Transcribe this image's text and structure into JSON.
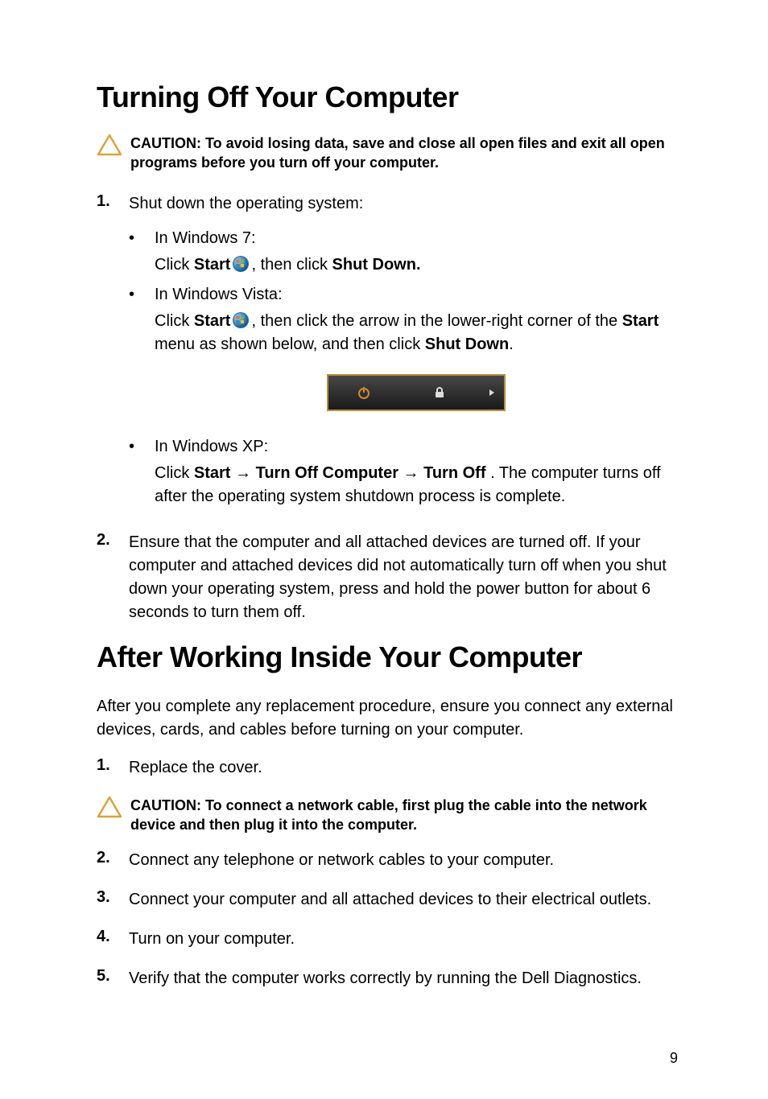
{
  "section1": {
    "heading": "Turning Off Your Computer",
    "caution": "CAUTION: To avoid losing data, save and close all open files and exit all open programs before you turn off your computer.",
    "step1_intro": "Shut down the operating system:",
    "win7_label": "In Windows 7:",
    "win7_pre": "Click ",
    "win7_start": "Start",
    "win7_post": ", then click ",
    "win7_shutdown": "Shut Down.",
    "vista_label": "In Windows Vista:",
    "vista_pre": "Click ",
    "vista_start": "Start",
    "vista_mid": ", then click the arrow in the lower-right corner of the ",
    "vista_start2": "Start",
    "vista_mid2": " menu as shown below, and then click ",
    "vista_shutdown": "Shut Down",
    "vista_period": ".",
    "xp_label": "In Windows XP:",
    "xp_pre": "Click ",
    "xp_start": "Start",
    "xp_arrow1": " → ",
    "xp_turnoffcomp": "Turn Off Computer",
    "xp_arrow2": " → ",
    "xp_turnoff": "Turn Off ",
    "xp_post": ". The computer turns off after the operating system shutdown process is complete.",
    "step2": "Ensure that the computer and all attached devices are turned off. If your computer and attached devices did not automatically turn off when you shut down your operating system, press and hold the power button for about 6 seconds to turn them off."
  },
  "section2": {
    "heading": "After Working Inside Your Computer",
    "intro": "After you complete any replacement procedure, ensure you connect any external devices, cards, and cables before turning on your computer.",
    "step1": "Replace the cover.",
    "caution": "CAUTION: To connect a network cable, first plug the cable into the network device and then plug it into the computer.",
    "step2": "Connect any telephone or network cables to your computer.",
    "step3": "Connect your computer and all attached devices to their electrical outlets.",
    "step4": "Turn on your computer.",
    "step5": "Verify that the computer works correctly by running the Dell Diagnostics."
  },
  "page_number": "9",
  "markers": {
    "n1": "1.",
    "n2": "2.",
    "n3": "3.",
    "n4": "4.",
    "n5": "5.",
    "bullet": "•"
  }
}
